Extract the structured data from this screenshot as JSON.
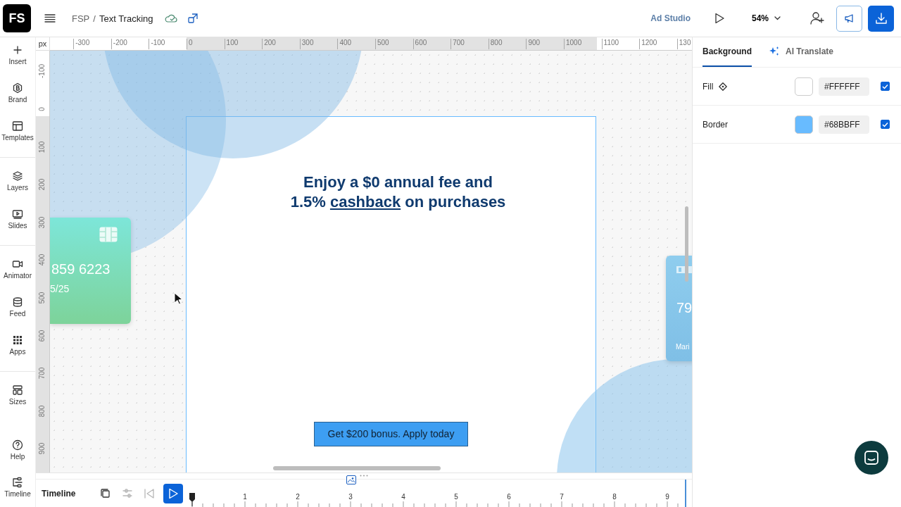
{
  "app": {
    "logo": "FS"
  },
  "breadcrumb": {
    "parent": "FSP",
    "separator": "/",
    "current": "Text Tracking"
  },
  "toolbar": {
    "studio_link": "Ad Studio",
    "zoom": "54%"
  },
  "sidebar": {
    "groups": [
      [
        {
          "label": "Insert"
        },
        {
          "label": "Brand"
        },
        {
          "label": "Templates"
        }
      ],
      [
        {
          "label": "Layers"
        },
        {
          "label": "Slides"
        }
      ],
      [
        {
          "label": "Animator"
        },
        {
          "label": "Feed"
        },
        {
          "label": "Apps"
        }
      ],
      [
        {
          "label": "Sizes"
        }
      ]
    ],
    "bottom_items": [
      {
        "label": "Help"
      },
      {
        "label": "Timeline"
      }
    ]
  },
  "rulers": {
    "unit": "px",
    "horizontal": [
      "-300",
      "-200",
      "-100",
      "0",
      "100",
      "200",
      "300",
      "400",
      "500",
      "600",
      "700",
      "800",
      "900",
      "1000",
      "1100",
      "1200",
      "130"
    ],
    "vertical": [
      "-100",
      "0",
      "100",
      "200",
      "300",
      "400",
      "500",
      "600",
      "700",
      "800",
      "900"
    ]
  },
  "canvas": {
    "artboard": {
      "headline": {
        "line_1": "Enjoy a $0 annual fee and",
        "line_2_before": "1.5% ",
        "link": "cashback",
        "line_2_after": " on purchases"
      },
      "cta": "Get $200 bonus. Apply today"
    },
    "cards": [
      {
        "kind": "green",
        "number": "859 6223",
        "expiry": "5/25"
      },
      {
        "kind": "blue",
        "number": "79",
        "holder": "Mari"
      }
    ]
  },
  "panel": {
    "tabs": [
      {
        "label": "Background",
        "selected": true
      },
      {
        "label": "AI Translate",
        "selected": false
      }
    ],
    "rows": [
      {
        "kind": "fill",
        "label": "Fill",
        "value": "#FFFFFF",
        "checked": true
      },
      {
        "kind": "border",
        "label": "Border",
        "value": "#68BBFF",
        "checked": true
      }
    ]
  },
  "timeline": {
    "title": "Timeline",
    "controls": [
      {
        "disabled": false
      },
      {
        "disabled": true
      },
      {
        "disabled": true
      }
    ],
    "marks": [
      "1",
      "2",
      "3",
      "4",
      "5",
      "6",
      "7",
      "8",
      "9"
    ]
  }
}
